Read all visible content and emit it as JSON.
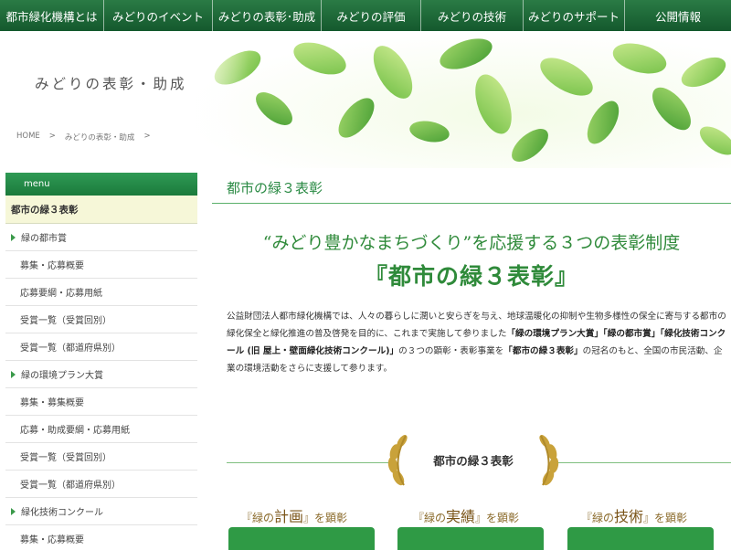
{
  "nav": {
    "items": [
      "都市緑化機構とは",
      "みどりのイベント",
      "みどりの表彰･助成",
      "みどりの評価",
      "みどりの技術",
      "みどりのサポート",
      "公開情報"
    ]
  },
  "hero": {
    "title": "みどりの表彰・助成"
  },
  "breadcrumb": {
    "home": "HOME",
    "sep1": ">",
    "current": "みどりの表彰・助成",
    "sep2": ">"
  },
  "sidebar": {
    "menu_label": "menu",
    "active": "都市の緑３表彰",
    "items": [
      {
        "label": "緑の都市賞",
        "level": 1
      },
      {
        "label": "募集・応募概要",
        "level": 2
      },
      {
        "label": "応募要綱・応募用紙",
        "level": 2
      },
      {
        "label": "受賞一覧（受賞回別）",
        "level": 2
      },
      {
        "label": "受賞一覧（都道府県別）",
        "level": 2
      },
      {
        "label": "緑の環境プラン大賞",
        "level": 1
      },
      {
        "label": "募集・募集概要",
        "level": 2
      },
      {
        "label": "応募・助成要綱・応募用紙",
        "level": 2
      },
      {
        "label": "受賞一覧（受賞回別）",
        "level": 2
      },
      {
        "label": "受賞一覧（都道府県別）",
        "level": 2
      },
      {
        "label": "緑化技術コンクール",
        "level": 1
      },
      {
        "label": "募集・応募概要",
        "level": 2
      }
    ]
  },
  "main": {
    "section_title": "都市の緑３表彰",
    "headline": "“みどり豊かなまちづくり”を応援する３つの表彰制度",
    "subhead": "『都市の緑３表彰』",
    "body": {
      "t1": "公益財団法人都市緑化機構では、人々の暮らしに潤いと安らぎを与え、地球温暖化の抑制や生物多様性の保全に寄与する都市の緑化保全と緑化推進の普及啓発を目的に、これまで実施して参りました",
      "b1": "「緑の環境プラン大賞」「緑の都市賞」「緑化技術コンクール (旧 屋上・壁面緑化技術コンクール)」",
      "t2": "の３つの顕彰・表彰事業を",
      "b2": "「都市の緑３表彰」",
      "t3": "の冠名のもと、全国の市民活動、企業の環境活動をさらに支援して参ります。"
    },
    "award_title": "都市の緑３表彰",
    "categories": [
      {
        "pre": "『緑の",
        "big": "計画",
        "post": "』を顕彰"
      },
      {
        "pre": "『緑の",
        "big": "実績",
        "post": "』を顕彰"
      },
      {
        "pre": "『緑の",
        "big": "技術",
        "post": "』を顕彰"
      }
    ]
  },
  "colors": {
    "nav_green": "#14592d",
    "accent_green": "#2a8a44",
    "menu_active_bg": "#f6f7d8",
    "laurel_gold": "#c9a23a"
  },
  "icons": [
    "leaf-image",
    "laurel-icon",
    "triangle-bullet-icon"
  ]
}
